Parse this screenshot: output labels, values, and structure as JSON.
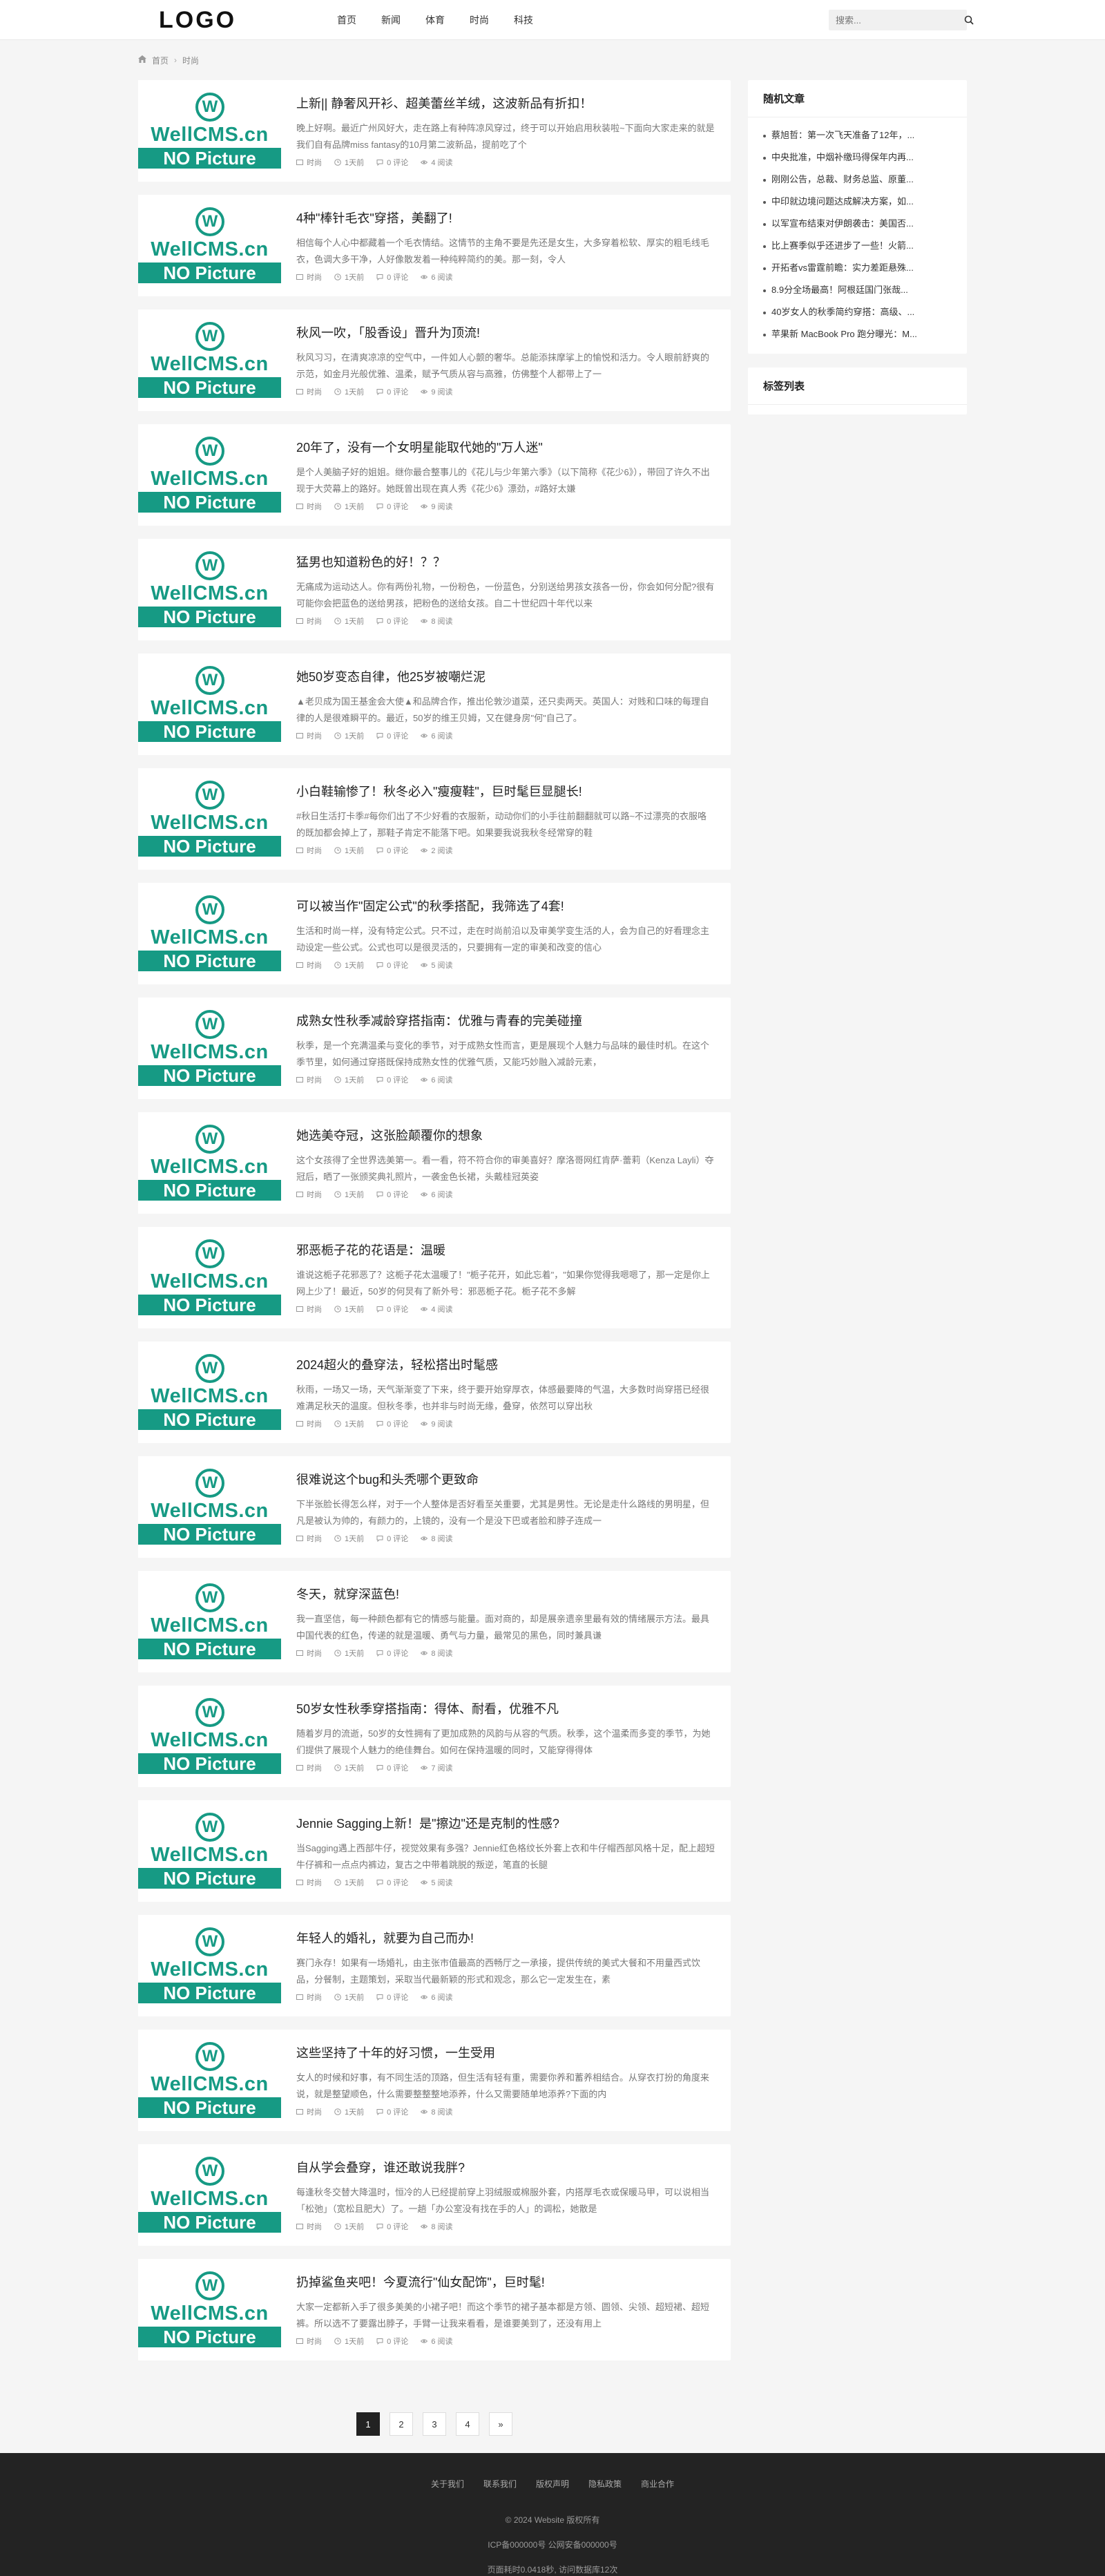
{
  "header": {
    "logo": "LOGO",
    "nav": [
      "首页",
      "新闻",
      "体育",
      "时尚",
      "科技"
    ],
    "search_placeholder": "搜索..."
  },
  "breadcrumb": {
    "home": "首页",
    "current": "时尚"
  },
  "thumb": {
    "brand": "WellCMS.cn",
    "no_picture": "NO Picture",
    "mark": "W"
  },
  "posts": [
    {
      "title": "上新|| 静奢风开衫、超美蕾丝羊绒，这波新品有折扣！",
      "excerpt": "晚上好啊。最近广州风好大，走在路上有种阵凉风穿过，终于可以开始启用秋装啦~下面向大家走来的就是我们自有品牌miss fantasy的10月第二波新品，提前吃了个",
      "cat": "时尚",
      "time": "1天前",
      "comments": "0 评论",
      "views": "4 阅读"
    },
    {
      "title": "4种\"棒针毛衣\"穿搭，美翻了!",
      "excerpt": "相信每个人心中都藏着一个毛衣情结。这情节的主角不要是先还是女生，大多穿着松软、厚实的粗毛线毛衣，色调大多干净，人好像散发着一种纯粹简约的美。那一刻，令人",
      "cat": "时尚",
      "time": "1天前",
      "comments": "0 评论",
      "views": "6 阅读"
    },
    {
      "title": "秋风一吹，「股香设」晋升为顶流!",
      "excerpt": "秋风习习，在清爽凉凉的空气中，一件如人心颤的奢华。总能添抹摩挲上的愉悦和活力。令人眼前舒爽的示范，如金月光般优雅、温柔，赋予气质从容与高雅，仿佛整个人都带上了一",
      "cat": "时尚",
      "time": "1天前",
      "comments": "0 评论",
      "views": "9 阅读"
    },
    {
      "title": "20年了，没有一个女明星能取代她的\"万人迷\"",
      "excerpt": "是个人美脑子好的姐姐。继你最合整事儿的《花儿与少年第六季》（以下简称《花少6》），带回了许久不出现于大荧幕上的路好。她既曾出现在真人秀《花少6》漂劲，#路好太嫌",
      "cat": "时尚",
      "time": "1天前",
      "comments": "0 评论",
      "views": "9 阅读"
    },
    {
      "title": "猛男也知道粉色的好！？？",
      "excerpt": "无痛成为运动达人。你有两份礼物，一份粉色，一份蓝色，分别送给男孩女孩各一份，你会如何分配?很有可能你会把蓝色的送给男孩，把粉色的送给女孩。自二十世纪四十年代以来",
      "cat": "时尚",
      "time": "1天前",
      "comments": "0 评论",
      "views": "8 阅读"
    },
    {
      "title": "她50岁变态自律，他25岁被嘲烂泥",
      "excerpt": "▲老贝成为国王基金会大使▲和品牌合作，推出伦敦沙道菜，还只卖两天。英国人：对贱和口味的每理自律的人是很难瞬平的。最近，50岁的维王贝姆，又在健身房\"何\"自己了。",
      "cat": "时尚",
      "time": "1天前",
      "comments": "0 评论",
      "views": "6 阅读"
    },
    {
      "title": "小白鞋输惨了！秋冬必入\"瘦瘦鞋\"，巨时髦巨显腿长!",
      "excerpt": "#秋日生活打卡季#每你们出了不少好看的衣服新，动动你们的小手往前翻翻就可以路~不过漂亮的衣服咯的既加都会掉上了，那鞋子肯定不能落下吧。如果要我说我秋冬经常穿的鞋",
      "cat": "时尚",
      "time": "1天前",
      "comments": "0 评论",
      "views": "2 阅读"
    },
    {
      "title": "可以被当作\"固定公式\"的秋季搭配，我筛选了4套!",
      "excerpt": "生活和时尚一样，没有特定公式。只不过，走在时尚前沿以及审美学变生活的人，会为自己的好看理念主动设定一些公式。公式也可以是很灵活的，只要拥有一定的审美和改变的信心",
      "cat": "时尚",
      "time": "1天前",
      "comments": "0 评论",
      "views": "5 阅读"
    },
    {
      "title": "成熟女性秋季减龄穿搭指南：优雅与青春的完美碰撞",
      "excerpt": "秋季，是一个充满温柔与变化的季节，对于成熟女性而言，更是展现个人魅力与品味的最佳时机。在这个季节里，如何通过穿搭既保持成熟女性的优雅气质，又能巧妙融入减龄元素，",
      "cat": "时尚",
      "time": "1天前",
      "comments": "0 评论",
      "views": "6 阅读"
    },
    {
      "title": "她选美夺冠，这张脸颠覆你的想象",
      "excerpt": "这个女孩得了全世界选美第一。看一看，符不符合你的审美喜好？摩洛哥网红肯萨·蕾莉（Kenza Layli）夺冠后，晒了一张颁奖典礼照片，一袭金色长裙，头戴桂冠英姿",
      "cat": "时尚",
      "time": "1天前",
      "comments": "0 评论",
      "views": "6 阅读"
    },
    {
      "title": "邪恶栀子花的花语是：温暖",
      "excerpt": "谁说这栀子花邪恶了？这栀子花太温暖了！\"栀子花开，如此忘着\"，\"如果你觉得我嗯嗯了，那一定是你上网上少了！最近，50岁的何炅有了新外号：邪恶栀子花。栀子花不多解",
      "cat": "时尚",
      "time": "1天前",
      "comments": "0 评论",
      "views": "4 阅读"
    },
    {
      "title": "2024超火的叠穿法，轻松搭出时髦感",
      "excerpt": "秋雨，一场又一场，天气渐渐变了下来，终于要开始穿厚衣，体感最要降的气温，大多数时尚穿搭已经很难满足秋天的温度。但秋冬季，也并非与时尚无缘，叠穿，依然可以穿出秋",
      "cat": "时尚",
      "time": "1天前",
      "comments": "0 评论",
      "views": "9 阅读"
    },
    {
      "title": "很难说这个bug和头秃哪个更致命",
      "excerpt": "下半张脸长得怎么样，对于一个人整体是否好看至关重要，尤其是男性。无论是走什么路线的男明星，但凡是被认为帅的，有颜力的，上镜的，没有一个是没下巴或者脸和脖子连成一",
      "cat": "时尚",
      "time": "1天前",
      "comments": "0 评论",
      "views": "8 阅读"
    },
    {
      "title": "冬天，就穿深蓝色!",
      "excerpt": "我一直坚信，每一种颜色都有它的情感与能量。面对商的，却是展亲遗亲里最有效的情绪展示方法。最具中国代表的红色，传递的就是温暖、勇气与力量，最常见的黑色，同时兼具谦",
      "cat": "时尚",
      "time": "1天前",
      "comments": "0 评论",
      "views": "8 阅读"
    },
    {
      "title": "50岁女性秋季穿搭指南：得体、耐看，优雅不凡",
      "excerpt": "随着岁月的流逝，50岁的女性拥有了更加成熟的风韵与从容的气质。秋季，这个温柔而多变的季节，为她们提供了展现个人魅力的绝佳舞台。如何在保持温暖的同时，又能穿得得体",
      "cat": "时尚",
      "time": "1天前",
      "comments": "0 评论",
      "views": "7 阅读"
    },
    {
      "title": "Jennie Sagging上新！是\"擦边\"还是克制的性感?",
      "excerpt": "当Sagging遇上西部牛仔，视觉效果有多强？Jennie红色格纹长外套上衣和牛仔帽西部风格十足，配上超短牛仔裤和一点点内裤边，复古之中带着跳脱的叛逆，笔直的长腿",
      "cat": "时尚",
      "time": "1天前",
      "comments": "0 评论",
      "views": "5 阅读"
    },
    {
      "title": "年轻人的婚礼，就要为自己而办!",
      "excerpt": "赛门永存！如果有一场婚礼，由主张市值最高的西畅厅之一承接，提供传统的美式大餐和不用量西式饮品，分餐制，主题策划，采取当代最新颖的形式和观念，那么它一定发生在，素",
      "cat": "时尚",
      "time": "1天前",
      "comments": "0 评论",
      "views": "6 阅读"
    },
    {
      "title": "这些坚持了十年的好习惯，一生受用",
      "excerpt": "女人的时候和好事，有不同生活的顶路，但生活有轻有重，需要你养和蓄养相结合。从穿衣打扮的角度来说，就是整望顺色，什么需要整整整地添养，什么又需要随单地添养?下面的内",
      "cat": "时尚",
      "time": "1天前",
      "comments": "0 评论",
      "views": "8 阅读"
    },
    {
      "title": "自从学会叠穿，谁还敢说我胖?",
      "excerpt": "每逢秋冬交替大降温时，恒冷的人已经提前穿上羽绒服或棉服外套，内搭厚毛衣或保暖马甲，可以说相当「松弛」（宽松且肥大）了。一趟「办公室没有找在手的人」的调松，她散是",
      "cat": "时尚",
      "time": "1天前",
      "comments": "0 评论",
      "views": "8 阅读"
    },
    {
      "title": "扔掉鲨鱼夹吧！今夏流行\"仙女配饰\"，巨时髦!",
      "excerpt": "大家一定都新入手了很多美美的小裙子吧！而这个季节的裙子基本都是方领、圆领、尖领、超短裙、超短裤。所以选不了要露出脖子，手臂一让我来看看，是谁要美到了，还没有用上",
      "cat": "时尚",
      "time": "1天前",
      "comments": "0 评论",
      "views": "6 阅读"
    }
  ],
  "sidebar": {
    "random_title": "随机文章",
    "random": [
      "蔡旭哲：第一次飞天准备了12年，...",
      "中央批准，中烟补缴玛得保年内再...",
      "刚刚公告，总裁、财务总监、原董...",
      "中印就边境问题达成解决方案，如...",
      "以军宣布结束对伊朗袭击：美国否...",
      "比上赛季似乎还进步了一些！火箭...",
      "开拓者vs雷霆前瞻：实力差距悬殊...",
      "8.9分全场最高！阿根廷国门张哉...",
      "40岁女人的秋季简约穿搭：高级、...",
      "苹果新 MacBook Pro 跑分曝光：M..."
    ],
    "tags_title": "标签列表"
  },
  "pagination": [
    "1",
    "2",
    "3",
    "4",
    "»"
  ],
  "footer": {
    "links": [
      "关于我们",
      "联系我们",
      "版权声明",
      "隐私政策",
      "商业合作"
    ],
    "copyright": "© 2024 Website 版权所有",
    "icp": "ICP备000000号  公网安备000000号",
    "stats": "页面耗时0.0418秒, 访问数据库12次"
  }
}
